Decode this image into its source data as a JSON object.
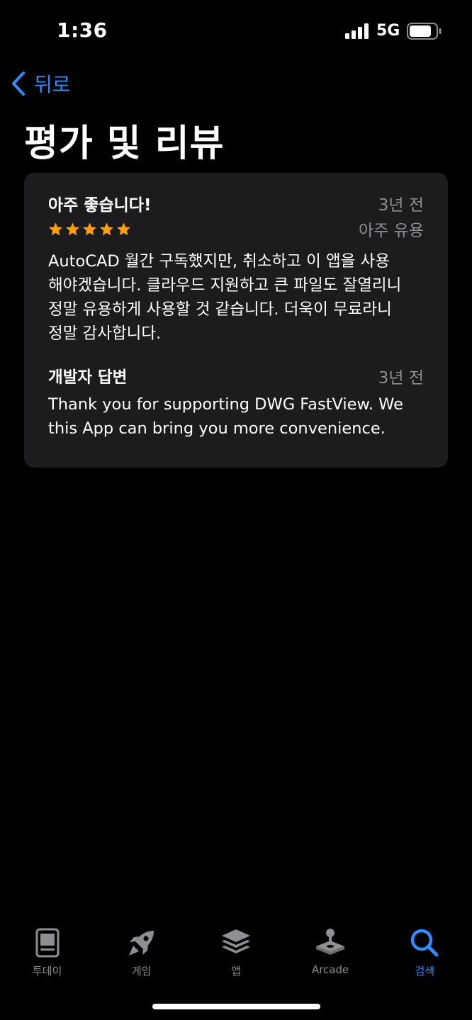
{
  "status_bar": {
    "time": "1:36",
    "network": "5G"
  },
  "nav": {
    "back_label": "뒤로"
  },
  "page": {
    "title": "평가 및 리뷰"
  },
  "review": {
    "title": "아주 좋습니다!",
    "date": "3년 전",
    "rating": 5,
    "rating_max": 5,
    "helpful_label": "아주 유용",
    "body": "AutoCAD 월간 구독했지만, 취소하고 이 앱을 사용\n해야겠습니다. 클라우드 지원하고 큰 파일도 잘열리니\n정말 유용하게 사용할 것 같습니다. 더욱이 무료라니\n정말 감사합니다.",
    "developer_response": {
      "title": "개발자 답변",
      "date": "3년 전",
      "body": "Thank you for supporting DWG FastView. We\nthis App can bring you more convenience."
    }
  },
  "tab_bar": {
    "items": [
      {
        "label": "투데이",
        "icon": "today-icon",
        "active": false
      },
      {
        "label": "게임",
        "icon": "rocket-icon",
        "active": false
      },
      {
        "label": "앱",
        "icon": "layers-icon",
        "active": false
      },
      {
        "label": "Arcade",
        "icon": "joystick-icon",
        "active": false
      },
      {
        "label": "검색",
        "icon": "search-icon",
        "active": true
      }
    ]
  },
  "colors": {
    "background": "#000000",
    "card": "#1c1c1e",
    "accent": "#2f8cff",
    "star": "#ff9f0a",
    "secondary_text": "#8e8e93"
  }
}
